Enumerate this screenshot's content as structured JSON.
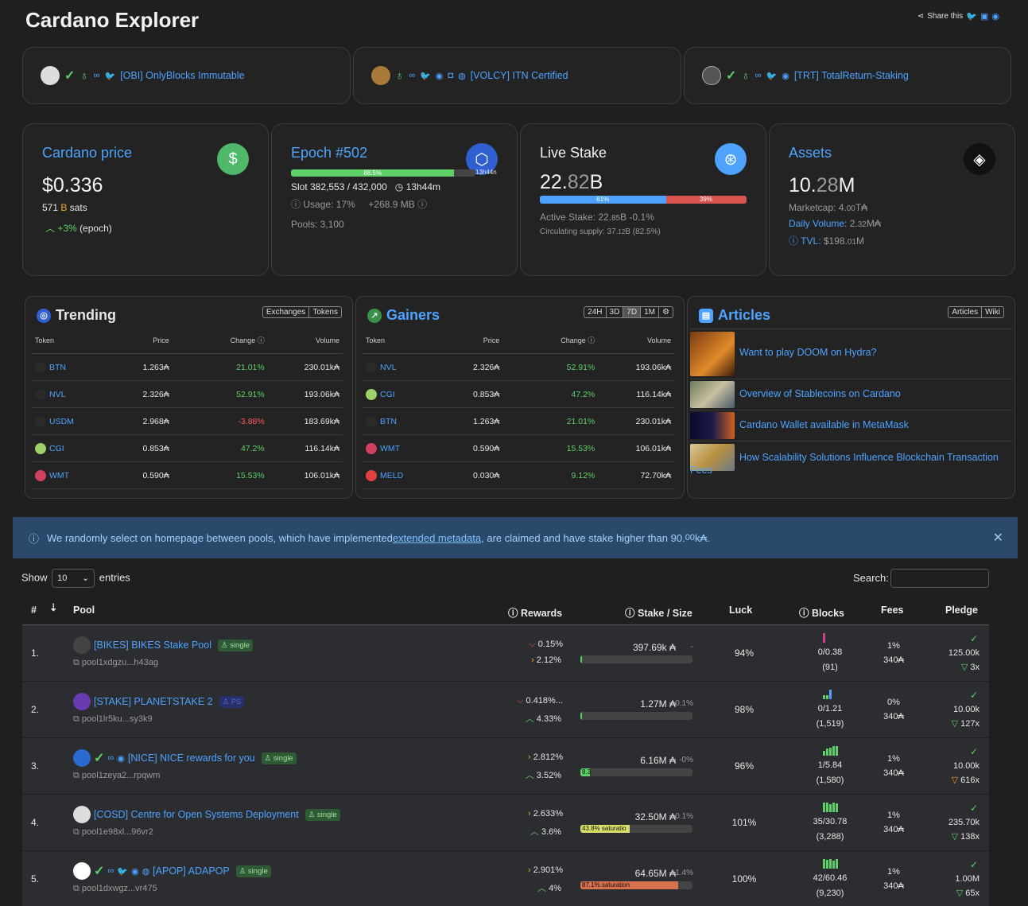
{
  "header": {
    "title": "Cardano Explorer",
    "share_label": "Share this"
  },
  "featured_pools": [
    {
      "label": "[OBI] OnlyBlocks Immutable"
    },
    {
      "label": "[VOLCY] ITN Certified"
    },
    {
      "label": "[TRT] TotalReturn-Staking"
    }
  ],
  "price": {
    "title": "Cardano price",
    "value": "$0.336",
    "sats": "571",
    "sats_unit": "sats",
    "change": "+3%",
    "change_suffix": "(epoch)"
  },
  "epoch": {
    "title": "Epoch #502",
    "progress_pct": 88.5,
    "progress_label": "88.5%",
    "remaining": "13h44n",
    "slot": "Slot 382,553 / 432,000",
    "time": "13h44m",
    "usage": "Usage: 17%",
    "size": "+268.9 MB",
    "pools": "Pools: 3,100"
  },
  "stake": {
    "title": "Live Stake",
    "value_main": "22.",
    "value_dim": "82",
    "value_unit": "B",
    "active_pct": 61,
    "active_label": "61%",
    "other_label": "39%",
    "active": "Active Stake: 22.",
    "active_dim": "85",
    "active_tail": "B -0.1%",
    "circulating": "Circulating supply: 37.",
    "circ_dim": "12",
    "circ_tail": "B (82.5%)"
  },
  "assets": {
    "title": "Assets",
    "value_main": "10.",
    "value_dim": "28",
    "value_unit": "M",
    "marketcap": "Marketcap: 4.",
    "marketcap_dim": "00",
    "marketcap_unit": "T₳",
    "daily_label": "Daily Volume:",
    "daily": " 2.",
    "daily_dim": "32",
    "daily_unit": "M₳",
    "tvl_label": "TVL:",
    "tvl": " $198.",
    "tvl_dim": "01",
    "tvl_unit": "M"
  },
  "trending": {
    "title": "Trending",
    "tabs": [
      "Exchanges",
      "Tokens"
    ],
    "headers": [
      "Token",
      "Price",
      "Change",
      "Volume"
    ],
    "rows": [
      {
        "token": "BTN",
        "price": "1.263₳",
        "change": "21.01%",
        "volume": "230.01k₳",
        "up": true
      },
      {
        "token": "NVL",
        "price": "2.326₳",
        "change": "52.91%",
        "volume": "193.06k₳",
        "up": true
      },
      {
        "token": "USDM",
        "price": "2.968₳",
        "change": "-3.88%",
        "volume": "183.69k₳",
        "up": false
      },
      {
        "token": "CGI",
        "price": "0.853₳",
        "change": "47.2%",
        "volume": "116.14k₳",
        "up": true
      },
      {
        "token": "WMT",
        "price": "0.590₳",
        "change": "15.53%",
        "volume": "106.01k₳",
        "up": true
      }
    ]
  },
  "gainers": {
    "title": "Gainers",
    "tabs": [
      "24H",
      "3D",
      "7D",
      "1M",
      "⚙"
    ],
    "headers": [
      "Token",
      "Price",
      "Change",
      "Volume"
    ],
    "rows": [
      {
        "token": "NVL",
        "price": "2.326₳",
        "change": "52.91%",
        "volume": "193.06k₳"
      },
      {
        "token": "CGI",
        "price": "0.853₳",
        "change": "47.2%",
        "volume": "116.14k₳"
      },
      {
        "token": "BTN",
        "price": "1.263₳",
        "change": "21.01%",
        "volume": "230.01k₳"
      },
      {
        "token": "WMT",
        "price": "0.590₳",
        "change": "15.53%",
        "volume": "106.01k₳"
      },
      {
        "token": "MELD",
        "price": "0.030₳",
        "change": "9.12%",
        "volume": "72.70k₳"
      }
    ]
  },
  "articles": {
    "title": "Articles",
    "tabs": [
      "Articles",
      "Wiki"
    ],
    "items": [
      {
        "title": "Want to play DOOM on Hydra?"
      },
      {
        "title": "Overview of Stablecoins on Cardano"
      },
      {
        "title": "Cardano Wallet available in MetaMask"
      },
      {
        "title": "How Scalability Solutions Influence Blockchain Transaction Fees"
      }
    ]
  },
  "notice": {
    "text_before": "We randomly select on homepage between pools, which have implemented ",
    "link": "extended metadata",
    "text_after": ", are claimed and have stake higher than 90.",
    "dim": "00",
    "unit": "k₳."
  },
  "table_ctrl": {
    "show": "Show",
    "entries_value": "10",
    "entries": "entries",
    "search": "Search:"
  },
  "table_headers": {
    "num": "#",
    "pool": "Pool",
    "rewards": "Rewards",
    "stake": "Stake / Size",
    "luck": "Luck",
    "blocks": "Blocks",
    "fees": "Fees",
    "pledge": "Pledge"
  },
  "pools": [
    {
      "rank": "1.",
      "name": "[BIKES] BIKES Stake Pool",
      "badge": "single",
      "id": "pool1xdgzu...h43ag",
      "r1": "0.15%",
      "r2": "2.12%",
      "stake": "397.69k ₳",
      "delta": "-",
      "sat_pct": 1,
      "sat_label": "",
      "luck": "94%",
      "blocks": "0/0.38",
      "blocks_total": "(91)",
      "fee": "1%",
      "fee_fixed": "340₳",
      "pledge": "125.00k",
      "mult": "3x"
    },
    {
      "rank": "2.",
      "name": "[STAKE] PLANETSTAKE 2",
      "badge": "PS",
      "id": "pool1lr5ku...sy3k9",
      "r1": "0.418%...",
      "r2": "4.33%",
      "stake": "1.27M ₳",
      "delta": "0.1%",
      "sat_pct": 1,
      "sat_label": "",
      "luck": "98%",
      "blocks": "0/1.21",
      "blocks_total": "(1,519)",
      "fee": "0%",
      "fee_fixed": "340₳",
      "pledge": "10.00k",
      "mult": "127x"
    },
    {
      "rank": "3.",
      "name": "[NICE] NICE rewards for you",
      "badge": "single",
      "id": "pool1zeya2...rpqwm",
      "r1": "2.812%",
      "r2": "3.52%",
      "stake": "6.16M ₳",
      "delta": "-0%",
      "sat_pct": 8.3,
      "sat_label": "8.3",
      "luck": "96%",
      "blocks": "1/5.84",
      "blocks_total": "(1,580)",
      "fee": "1%",
      "fee_fixed": "340₳",
      "pledge": "10.00k",
      "mult": "616x"
    },
    {
      "rank": "4.",
      "name": "[COSD] Centre for Open Systems Deployment",
      "badge": "single",
      "id": "pool1e98xl...96vr2",
      "r1": "2.633%",
      "r2": "3.6%",
      "stake": "32.50M ₳",
      "delta": "0.1%",
      "sat_pct": 43.8,
      "sat_label": "43.8% saturatio",
      "luck": "101%",
      "blocks": "35/30.78",
      "blocks_total": "(3,288)",
      "fee": "1%",
      "fee_fixed": "340₳",
      "pledge": "235.70k",
      "mult": "138x"
    },
    {
      "rank": "5.",
      "name": "[APOP] ADAPOP",
      "badge": "single",
      "id": "pool1dxwgz...vr475",
      "r1": "2.901%",
      "r2": "4%",
      "stake": "64.65M ₳",
      "delta": "+1.4%",
      "sat_pct": 87.1,
      "sat_label": "87.1% saturation",
      "luck": "100%",
      "blocks": "42/60.46",
      "blocks_total": "(9,230)",
      "fee": "1%",
      "fee_fixed": "340₳",
      "pledge": "1.00M",
      "mult": "65x"
    }
  ]
}
